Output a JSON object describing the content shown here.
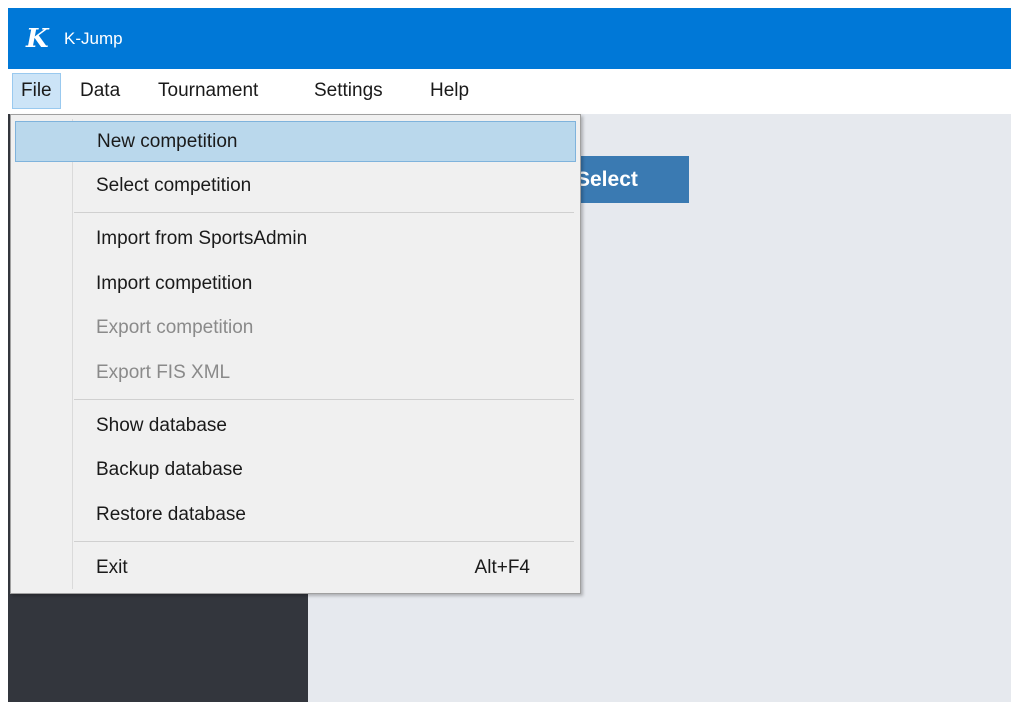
{
  "window": {
    "app_title": "K-Jump",
    "logo_letter": "K",
    "colors": {
      "titlebar": "#0078d7",
      "menu_active_bg": "#cce4f7",
      "dropdown_bg": "#f0f0f0",
      "highlight_bg": "#bad8ec",
      "sidebar_bg": "#33363d",
      "workspace_bg": "#e6e9ee",
      "select_button_bg": "#3a7ab2"
    }
  },
  "menubar": {
    "items": [
      {
        "label": "File"
      },
      {
        "label": "Data"
      },
      {
        "label": "Tournament"
      },
      {
        "label": "Settings"
      },
      {
        "label": "Help"
      }
    ]
  },
  "workspace": {
    "select_button_label": "Select"
  },
  "file_menu": {
    "items": [
      {
        "label": "New competition",
        "shortcut": "",
        "enabled": true,
        "highlighted": true
      },
      {
        "label": "Select competition",
        "shortcut": "",
        "enabled": true
      },
      {
        "label": "Import from SportsAdmin",
        "shortcut": "",
        "enabled": true
      },
      {
        "label": "Import competition",
        "shortcut": "",
        "enabled": true
      },
      {
        "label": "Export competition",
        "shortcut": "",
        "enabled": false
      },
      {
        "label": "Export FIS XML",
        "shortcut": "",
        "enabled": false
      },
      {
        "label": "Show database",
        "shortcut": "",
        "enabled": true
      },
      {
        "label": "Backup database",
        "shortcut": "",
        "enabled": true
      },
      {
        "label": "Restore database",
        "shortcut": "",
        "enabled": true
      },
      {
        "label": "Exit",
        "shortcut": "Alt+F4",
        "enabled": true
      }
    ]
  }
}
